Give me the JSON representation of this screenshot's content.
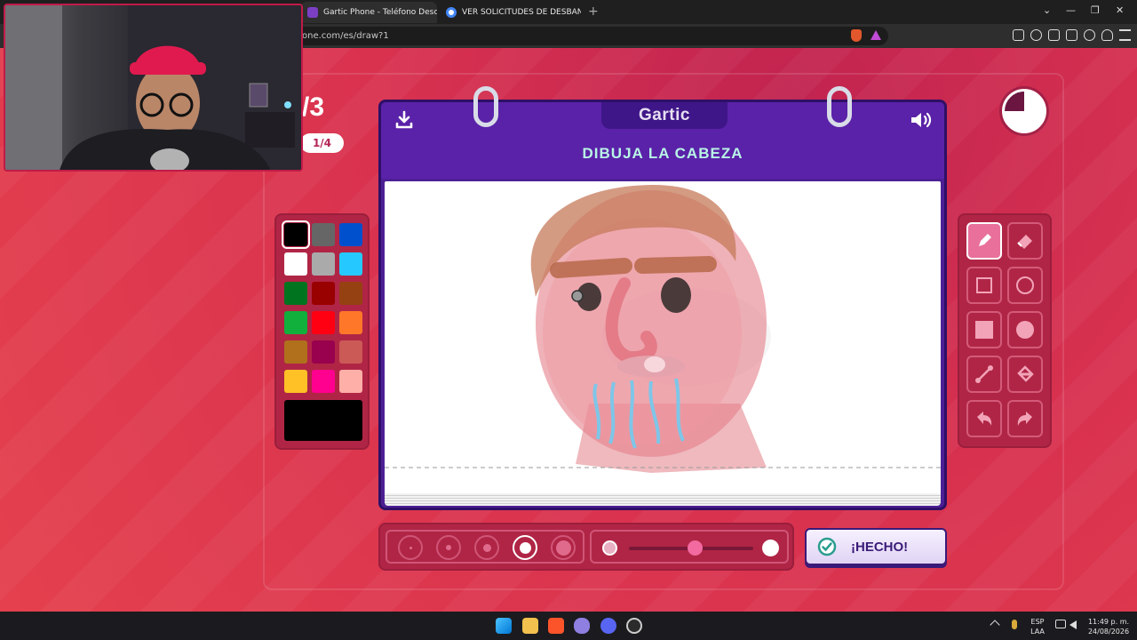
{
  "browser": {
    "tabs": [
      {
        "title": "Gartic Phone - Teléfono Descom",
        "close": "✕"
      },
      {
        "title": "VER SOLICITUDES DE DESBANEO EN",
        "close": "✕"
      }
    ],
    "new_tab": "+",
    "url": "one.com/es/draw?1",
    "window_controls": [
      "⌄",
      "—",
      "❐",
      "✕"
    ]
  },
  "game": {
    "round_label": "/3",
    "round_progress": "1/4",
    "logo": "Gartic",
    "prompt": "DIBUJA LA CABEZA",
    "done_button": "¡HECHO!",
    "timer_remaining": 0.75,
    "palette": [
      "#000000",
      "#666666",
      "#0050cd",
      "#ffffff",
      "#aaaaaa",
      "#26c9ff",
      "#017420",
      "#990000",
      "#964112",
      "#11b03c",
      "#ff0013",
      "#ff7829",
      "#b0701c",
      "#99004e",
      "#cb5a57",
      "#ffc126",
      "#ff008f",
      "#feafa8"
    ],
    "selected_color": "#000000",
    "tools": [
      "pen-icon",
      "bucket-eraser-icon",
      "rect-outline-icon",
      "circle-outline-icon",
      "rect-filled-icon",
      "circle-filled-icon",
      "line-icon",
      "fill-icon",
      "undo-icon",
      "redo-icon"
    ],
    "selected_tool": "pen-icon",
    "brush_sizes": [
      1,
      2,
      3,
      4,
      5
    ],
    "selected_brush_size": 4,
    "opacity": 0.55
  },
  "taskbar": {
    "lang": "ESP",
    "layout": "LAA",
    "time": "11:49 p. m.",
    "date": "24/08/2026"
  }
}
